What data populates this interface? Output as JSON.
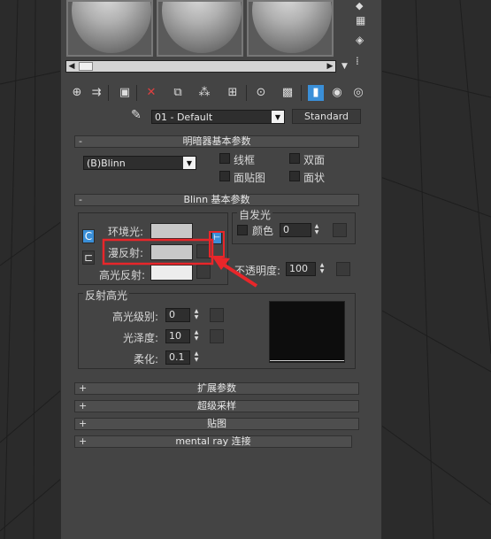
{
  "material_slots": [
    "sphere-1",
    "sphere-2",
    "sphere-3"
  ],
  "toolbar": {
    "icons": [
      "get-material-icon",
      "put-to-scene-icon",
      "assign-to-selection-icon",
      "reset-icon",
      "make-copy-icon",
      "make-unique-icon",
      "put-to-library-icon",
      "material-id-icon",
      "show-in-viewport-icon",
      "show-end-result-icon",
      "go-to-parent-icon",
      "go-forward-icon"
    ]
  },
  "material_name": "01 - Default",
  "material_type_button": "Standard",
  "shader_rollout": {
    "title": "明暗器基本参数",
    "shader_value": "(B)Blinn",
    "wire": "线框",
    "two_sided": "双面",
    "face_map": "面贴图",
    "faceted": "面状"
  },
  "blinn_rollout": {
    "title": "Blinn 基本参数",
    "ambient_label": "环境光:",
    "diffuse_label": "漫反射:",
    "specular_label": "高光反射:",
    "self_illum_group": "自发光",
    "color_label": "颜色",
    "self_illum_value": "0",
    "opacity_label": "不透明度:",
    "opacity_value": "100",
    "spec_highlights_group": "反射高光",
    "spec_level_label": "高光级别:",
    "spec_level_value": "0",
    "gloss_label": "光泽度:",
    "gloss_value": "10",
    "soften_label": "柔化:",
    "soften_value": "0.1"
  },
  "collapsed_rollouts": [
    "扩展参数",
    "超级采样",
    "贴图",
    "mental ray 连接"
  ],
  "colors": {
    "highlight_red": "#e8262a",
    "active_blue": "#3a8fd8",
    "panel_bg": "#444444"
  }
}
